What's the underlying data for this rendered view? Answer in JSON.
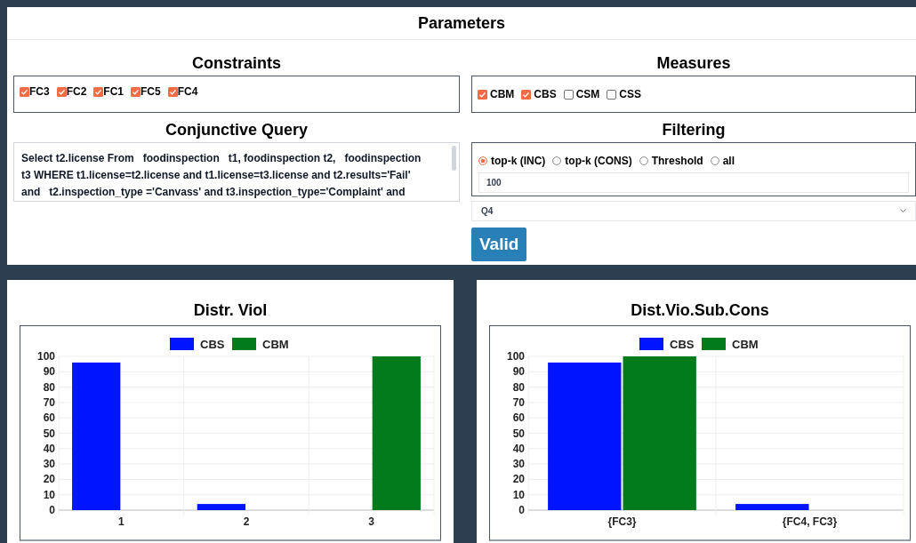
{
  "parameters": {
    "title": "Parameters",
    "constraints": {
      "title": "Constraints",
      "items": [
        {
          "label": "FC3",
          "checked": true
        },
        {
          "label": "FC2",
          "checked": true
        },
        {
          "label": "FC1",
          "checked": true
        },
        {
          "label": "FC5",
          "checked": true
        },
        {
          "label": "FC4",
          "checked": true
        }
      ]
    },
    "query": {
      "title": "Conjunctive Query",
      "value": "Select t2.license From   foodinspection   t1, foodinspection t2,   foodinspection t3 WHERE t1.license=t2.license and t1.license=t3.license and t2.results='Fail'  and   t2.inspection_type ='Canvass' and t3.inspection_type='Complaint' and"
    },
    "measures": {
      "title": "Measures",
      "items": [
        {
          "label": "CBM",
          "checked": true
        },
        {
          "label": "CBS",
          "checked": true
        },
        {
          "label": "CSM",
          "checked": false
        },
        {
          "label": "CSS",
          "checked": false
        }
      ]
    },
    "filtering": {
      "title": "Filtering",
      "options": [
        {
          "label": "top-k (INC)",
          "selected": true
        },
        {
          "label": "top-k (CONS)",
          "selected": false
        },
        {
          "label": "Threshold",
          "selected": false
        },
        {
          "label": "all",
          "selected": false
        }
      ],
      "value": "100"
    },
    "query_select": {
      "value": "Q4"
    },
    "button": "Valid"
  },
  "charts": [
    {
      "chart_data": {
        "type": "bar",
        "title": "Distr. Viol",
        "grid": true,
        "legend": "top",
        "categories": [
          "1",
          "2",
          "3"
        ],
        "series": [
          {
            "name": "CBS",
            "color": "#0014ff",
            "values": [
              96,
              4,
              null
            ]
          },
          {
            "name": "CBM",
            "color": "#027b1d",
            "values": [
              null,
              null,
              100
            ]
          }
        ],
        "ylim": [
          0,
          100
        ],
        "yticks": [
          0,
          10,
          20,
          30,
          40,
          50,
          60,
          70,
          80,
          90,
          100
        ]
      }
    },
    {
      "chart_data": {
        "type": "bar",
        "title": "Dist.Vio.Sub.Cons",
        "grid": true,
        "legend": "top",
        "categories": [
          "{FC3}",
          "{FC4, FC3}"
        ],
        "series": [
          {
            "name": "CBS",
            "color": "#0014ff",
            "values": [
              96,
              4
            ]
          },
          {
            "name": "CBM",
            "color": "#027b1d",
            "values": [
              100,
              null
            ]
          }
        ],
        "ylim": [
          0,
          100
        ],
        "yticks": [
          0,
          10,
          20,
          30,
          40,
          50,
          60,
          70,
          80,
          90,
          100
        ]
      }
    }
  ]
}
